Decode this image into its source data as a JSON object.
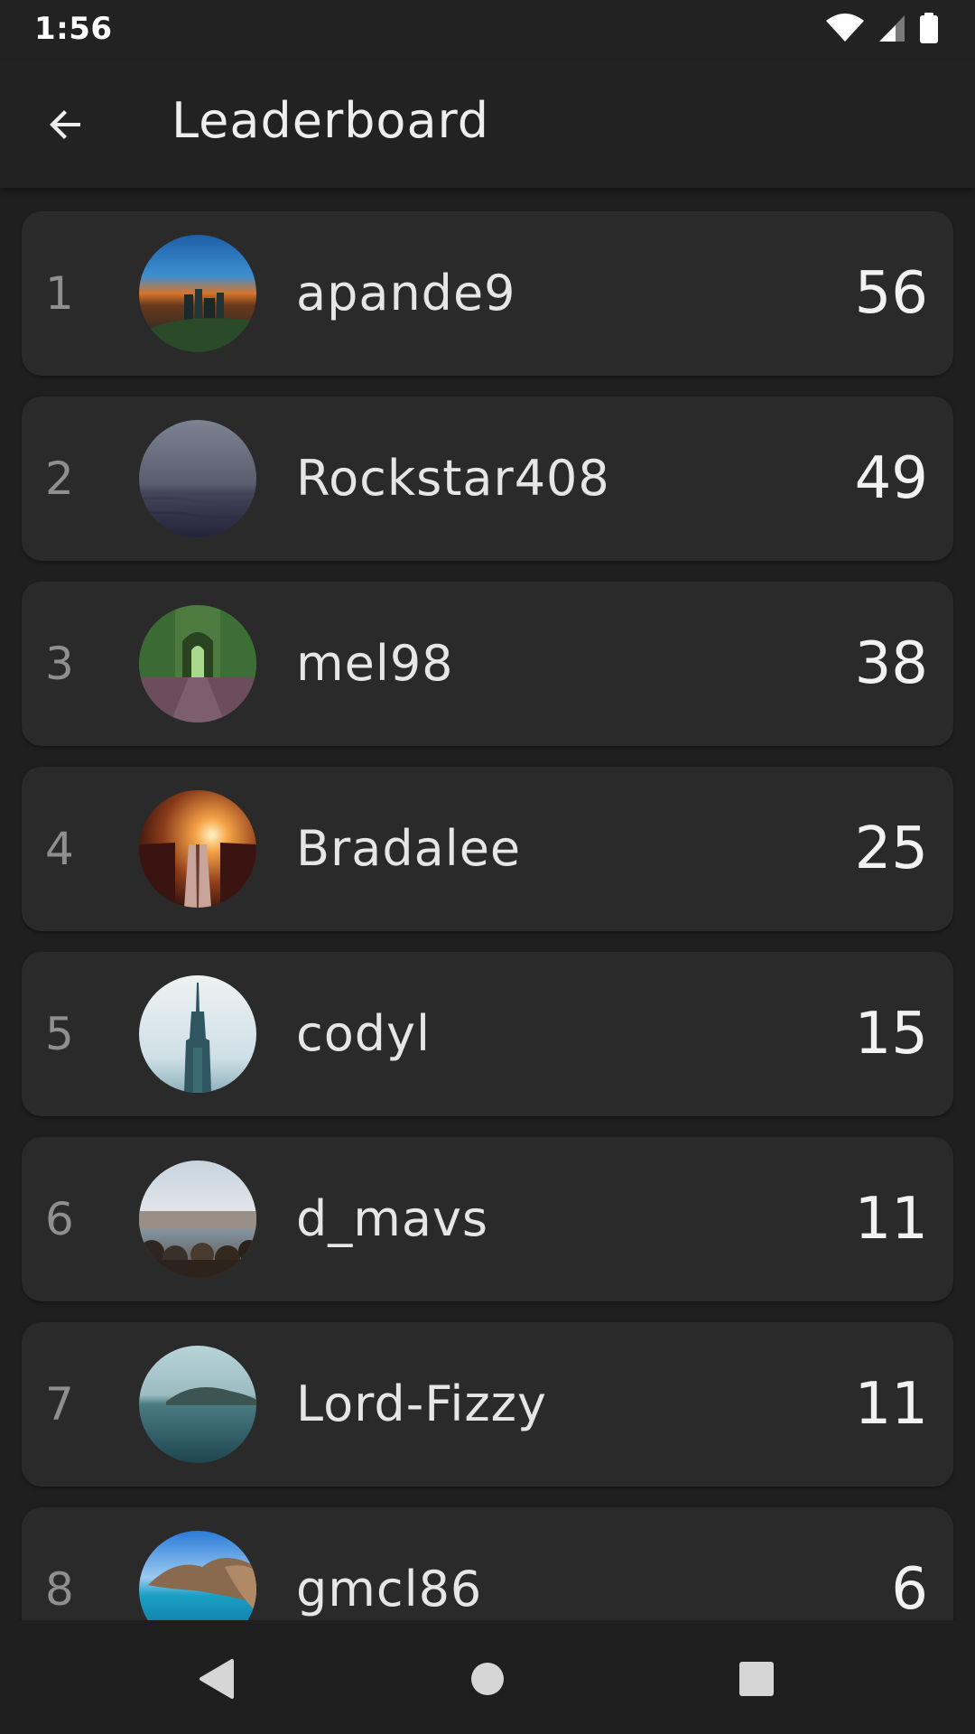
{
  "status_bar": {
    "time": "1:56"
  },
  "app_bar": {
    "title": "Leaderboard",
    "back_icon": "arrow-back-icon"
  },
  "colors": {
    "background": "#1f1f1f",
    "bar": "#222222",
    "card": "#2a2a2a",
    "rank_text": "#8f8f8f",
    "primary_text": "#e6e6e6"
  },
  "leaderboard": [
    {
      "rank": "1",
      "username": "apande9",
      "score": "56",
      "avatar": "city-sunset"
    },
    {
      "rank": "2",
      "username": "Rockstar408",
      "score": "49",
      "avatar": "misty-sea"
    },
    {
      "rank": "3",
      "username": "mel98",
      "score": "38",
      "avatar": "forest-arch"
    },
    {
      "rank": "4",
      "username": "Bradalee",
      "score": "25",
      "avatar": "sunset-road"
    },
    {
      "rank": "5",
      "username": "codyl",
      "score": "15",
      "avatar": "tower-sky"
    },
    {
      "rank": "6",
      "username": "d_mavs",
      "score": "11",
      "avatar": "crowd-coast"
    },
    {
      "rank": "7",
      "username": "Lord-Fizzy",
      "score": "11",
      "avatar": "lake-mountains"
    },
    {
      "rank": "8",
      "username": "gmcl86",
      "score": "6",
      "avatar": "island-cliffs"
    }
  ],
  "nav_bar": {
    "back_icon": "nav-back-triangle-icon",
    "home_icon": "nav-home-circle-icon",
    "recents_icon": "nav-recents-square-icon"
  }
}
